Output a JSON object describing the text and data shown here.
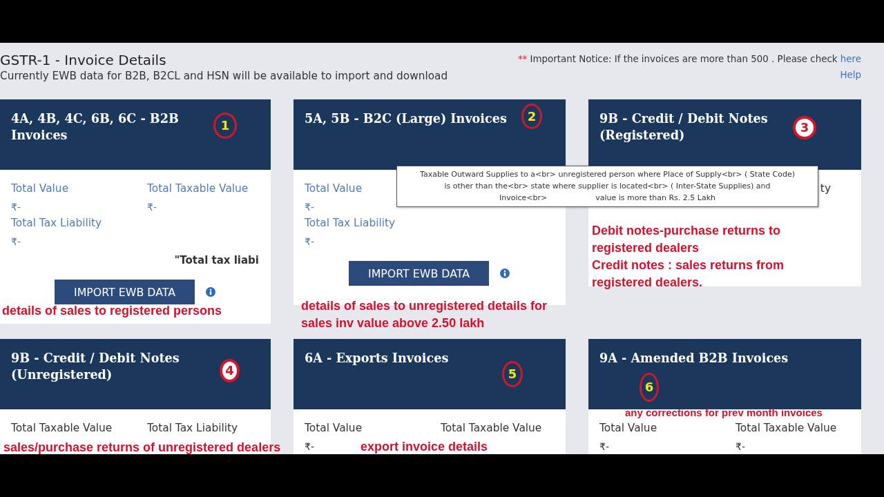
{
  "header": {
    "title": "GSTR-1 - Invoice Details",
    "subtitle": "Currently EWB data for B2B, B2CL and HSN will be available to import and download",
    "notice": {
      "mark": "**",
      "text": "Important Notice: If the invoices are more than 500 . Please check",
      "link": "here"
    },
    "help_link": "Help"
  },
  "cards": [
    {
      "title": "4A, 4B, 4C, 6B, 6C - B2B Invoices",
      "highlighted": true,
      "rows": [
        [
          {
            "label": "Total Value",
            "value": "₹-"
          },
          {
            "label": "Total Taxable Value",
            "value": "₹-"
          }
        ],
        [
          {
            "label": "Total Tax Liability",
            "value": "₹-"
          }
        ]
      ],
      "note": "\"Total tax liabi",
      "button": "IMPORT EWB DATA"
    },
    {
      "title": "5A, 5B - B2C (Large) Invoices",
      "highlighted": true,
      "rows": [
        [
          {
            "label": "Total Value",
            "value": "₹-"
          }
        ],
        [
          {
            "label": "Total Tax Liability",
            "value": "₹-"
          }
        ]
      ],
      "button": "IMPORT EWB DATA"
    },
    {
      "title": "9B - Credit / Debit Notes (Registered)",
      "highlighted": false,
      "covered_label": "ty"
    },
    {
      "title": "9B - Credit / Debit Notes (Unregistered)",
      "highlighted": false,
      "rows": [
        [
          {
            "label": "Total Taxable Value"
          },
          {
            "label": "Total Tax Liability"
          }
        ]
      ]
    },
    {
      "title": "6A - Exports Invoices",
      "highlighted": false,
      "rows": [
        [
          {
            "label": "Total Value",
            "value": "₹-"
          },
          {
            "label": "Total Taxable Value"
          }
        ]
      ]
    },
    {
      "title": "9A - Amended B2B Invoices",
      "highlighted": false,
      "rows": [
        [
          {
            "label": "Total Value",
            "value": "₹-"
          },
          {
            "label": "Total Taxable Value",
            "value": "₹-"
          }
        ]
      ]
    }
  ],
  "tooltip": {
    "lines": [
      "Taxable Outward Supplies to a<br> unregistered person where Place of Supply<br> ( State Code)",
      "is other than the<br> state where supplier is located<br> ( Inter-State Supplies) and",
      "Invoice<br>                    value is more than Rs. 2.5 Lakh"
    ]
  },
  "markers": [
    {
      "number": "1",
      "kind": "ring"
    },
    {
      "number": "2",
      "kind": "ring"
    },
    {
      "number": "3",
      "kind": "solid"
    },
    {
      "number": "4",
      "kind": "solid"
    },
    {
      "number": "5",
      "kind": "ring"
    },
    {
      "number": "6",
      "kind": "ring"
    }
  ],
  "annotations": [
    "details of sales to registered persons",
    "details of sales to unregistered details for sales inv value above 2.50 lakh",
    "Debit notes-purchase returns to registered dealers",
    "Credit notes : sales returns from registered dealers.",
    "sales/purchase returns of unregistered dealers",
    "export invoice details",
    "any corrections for prev month invoices"
  ]
}
